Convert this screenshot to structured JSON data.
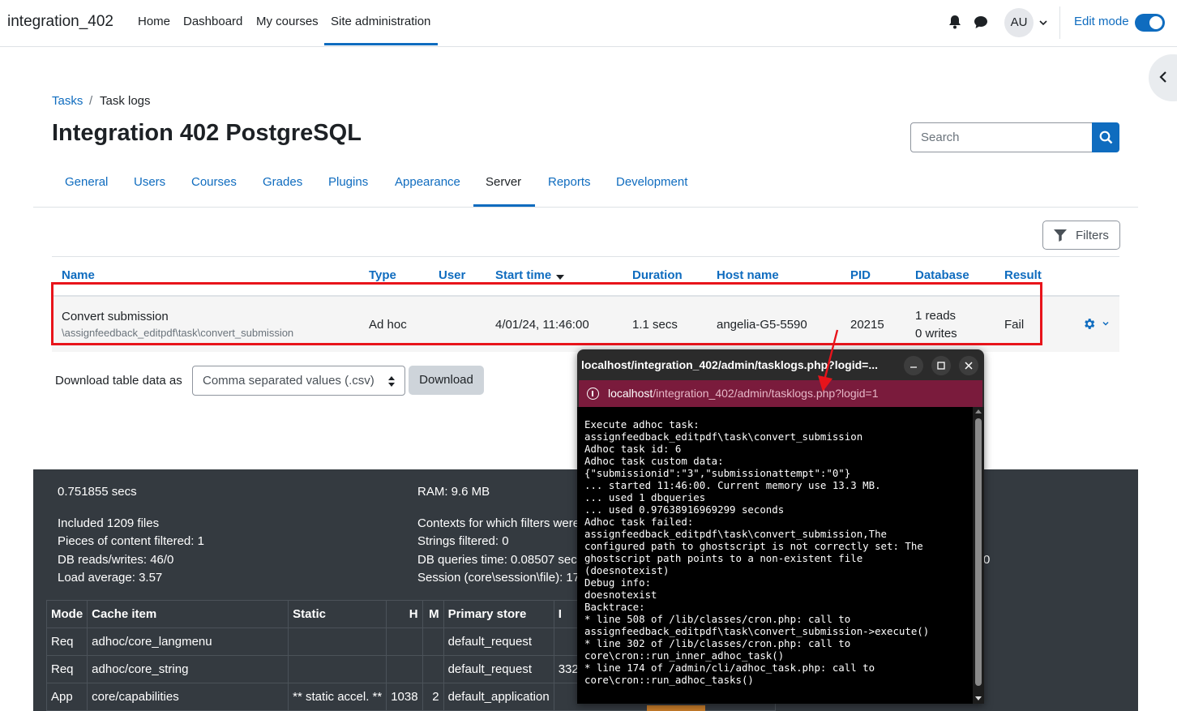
{
  "navbar": {
    "brand": "integration_402",
    "items": [
      "Home",
      "Dashboard",
      "My courses",
      "Site administration"
    ],
    "active_item": "Site administration",
    "avatar_initials": "AU",
    "edit_mode_label": "Edit mode",
    "edit_mode_on": true
  },
  "breadcrumb": {
    "items": [
      "Tasks",
      "Task logs"
    ]
  },
  "page_title": "Integration 402 PostgreSQL",
  "search": {
    "placeholder": "Search"
  },
  "tabs": [
    "General",
    "Users",
    "Courses",
    "Grades",
    "Plugins",
    "Appearance",
    "Server",
    "Reports",
    "Development"
  ],
  "active_tab": "Server",
  "filters_label": "Filters",
  "table": {
    "headers": [
      "Name",
      "Type",
      "User",
      "Start time",
      "Duration",
      "Host name",
      "PID",
      "Database",
      "Result"
    ],
    "sorted_by": "Start time",
    "row": {
      "name": "Convert submission",
      "classname": "\\assignfeedback_editpdf\\task\\convert_submission",
      "type": "Ad hoc",
      "user": "",
      "start_time": "4/01/24, 11:46:00",
      "duration": "1.1 secs",
      "host": "angelia-G5-5590",
      "pid": "20215",
      "db_reads": "1 reads",
      "db_writes": "0 writes",
      "result": "Fail"
    }
  },
  "download": {
    "label": "Download table data as",
    "format": "Comma separated values (.csv)",
    "button": "Download"
  },
  "footer": {
    "time": "0.751855 secs",
    "ram": "RAM: 9.6 MB",
    "included": "Included 1209 files",
    "pieces": "Pieces of content filtered: 1",
    "dbrw": "DB reads/writes: 46/0",
    "load": "Load average: 3.57",
    "contexts": "Contexts for which filters were",
    "strings": "Strings filtered: 0",
    "dbtime": "DB queries time: 0.08507 sec",
    "session": "Session (core\\session\\file): 17",
    "stray_digit": "0",
    "cache_headers": [
      "Mode",
      "Cache item",
      "Static",
      "H",
      "M",
      "Primary store",
      "I"
    ],
    "cache_rows": [
      [
        "Req",
        "adhoc/core_langmenu",
        "",
        "",
        "",
        "default_request",
        ""
      ],
      [
        "Req",
        "adhoc/core_string",
        "",
        "",
        "",
        "default_request",
        "332"
      ],
      [
        "App",
        "core/capabilities",
        "** static accel. **",
        "1038",
        "2",
        "default_application",
        ""
      ]
    ]
  },
  "popup": {
    "title": "localhost/integration_402/admin/tasklogs.php?logid=...",
    "url_host": "localhost",
    "url_path": "/integration_402/admin/tasklogs.php?logid=1",
    "log": "Execute adhoc task:\nassignfeedback_editpdf\\task\\convert_submission\nAdhoc task id: 6\nAdhoc task custom data:\n{\"submissionid\":\"3\",\"submissionattempt\":\"0\"}\n... started 11:46:00. Current memory use 13.3 MB.\n... used 1 dbqueries\n... used 0.97638916969299 seconds\nAdhoc task failed:\nassignfeedback_editpdf\\task\\convert_submission,The\nconfigured path to ghostscript is not correctly set: The\nghostscript path points to a non-existent file\n(doesnotexist)\nDebug info:\ndoesnotexist\nBacktrace:\n* line 508 of /lib/classes/cron.php: call to\nassignfeedback_editpdf\\task\\convert_submission->execute()\n* line 302 of /lib/classes/cron.php: call to\ncore\\cron::run_inner_adhoc_task()\n* line 174 of /admin/cli/adhoc_task.php: call to\ncore\\cron::run_adhoc_tasks()"
  },
  "colors": {
    "brand_blue": "#0f6cbf",
    "highlight_red": "#e8141b",
    "footer_bg": "#343a40",
    "popup_url_bar": "#7a1b3c"
  }
}
